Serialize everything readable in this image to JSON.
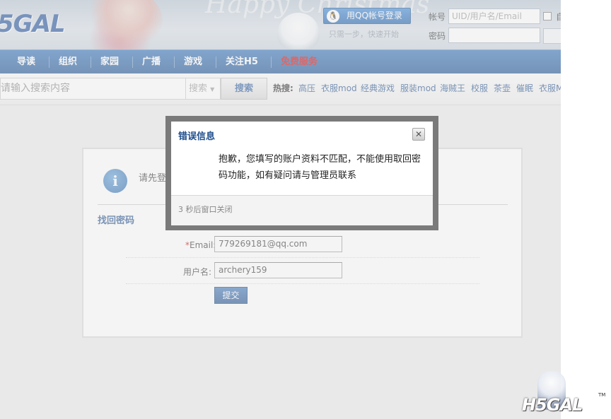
{
  "header": {
    "logo": "5GAL",
    "banner_script": "Happy Christmas",
    "qq_login": {
      "label": "用QQ帐号登录",
      "icon": "qq-penguin-icon"
    },
    "qq_hint": "只需一步，快速开始",
    "account_label": "帐号",
    "account_placeholder": "UID/用户名/Email",
    "password_label": "密码",
    "remember_label": "自"
  },
  "nav": {
    "items": [
      "导读",
      "组织",
      "家园",
      "广播",
      "游戏",
      "关注H5",
      "免费服务"
    ],
    "highlight_color": "#d40000"
  },
  "search": {
    "placeholder": "请输入搜索内容",
    "select_value": "搜索",
    "button_label": "搜索",
    "hot_label": "热搜:",
    "hot_links": [
      "高压",
      "衣服mod",
      "经典游戏",
      "服装mod",
      "海贼王",
      "校服",
      "茶壶",
      "催眠",
      "衣服M"
    ]
  },
  "content": {
    "notice": "请先登录",
    "retrieve_title": "找回密码",
    "email_required_mark": "*",
    "email_label": "Email:",
    "email_value": "779269181@qq.com",
    "username_label": "用户名:",
    "username_value": "archery159",
    "submit_label": "提交"
  },
  "modal": {
    "title": "错误信息",
    "close_glyph": "✕",
    "message": "抱歉，您填写的账户资料不匹配，不能使用取回密码功能，如有疑问请与管理员联系",
    "countdown": "3 秒后窗口关闭"
  },
  "watermark": {
    "logo": "H5GAL",
    "tm": "TM"
  },
  "colors": {
    "nav_bg": "#1a4f91",
    "link": "#1f4e8c",
    "modal_frame": "#7a7a7a"
  }
}
